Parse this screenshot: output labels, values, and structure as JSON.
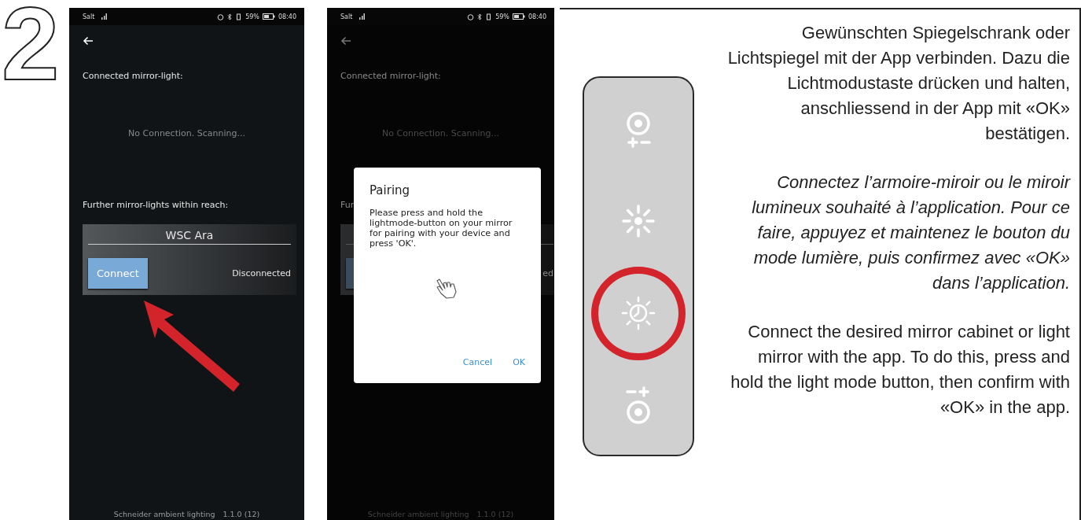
{
  "step_number": "2",
  "phones": [
    {
      "kind": "connect",
      "status_bar": {
        "carrier": "Salt",
        "battery": "59%",
        "time": "08:40"
      },
      "connected_label": "Connected mirror-light:",
      "scanning_text": "No Connection. Scanning...",
      "further_label": "Further mirror-lights within reach:",
      "device": {
        "name": "WSC Ara",
        "button": "Connect",
        "status": "Disconnected"
      },
      "footer": {
        "app_name": "Schneider ambient lighting",
        "version": "1.1.0 (12)"
      }
    },
    {
      "kind": "pairing",
      "status_bar": {
        "carrier": "Salt",
        "battery": "59%",
        "time": "08:40"
      },
      "connected_label": "Connected mirror-light:",
      "scanning_text": "No Connection. Scanning...",
      "further_label": "Fur",
      "device": {
        "status": "ed"
      },
      "footer": {
        "app_name": "Schneider ambient lighting",
        "version": "1.1.0 (12)"
      },
      "dialog": {
        "title": "Pairing",
        "message": "Please press and hold the lightmode-button on your mirror for pairing with your device and press 'OK'.",
        "buttons": [
          "Cancel",
          "OK"
        ]
      }
    }
  ],
  "mirror_control": {
    "buttons": [
      {
        "kind": "brightness-plus-minus",
        "circled": false
      },
      {
        "kind": "sun",
        "circled": false
      },
      {
        "kind": "timer-sun",
        "circled": true
      },
      {
        "kind": "minus-plus",
        "circled": false
      }
    ]
  },
  "instructions": [
    {
      "kind": "normal",
      "text": "Gewünschten Spiegelschrank oder Lichtspiegel mit der App verbinden. Dazu die Lichtmodustaste drücken und halten, anschliessend in der App mit «OK» bestätigen."
    },
    {
      "kind": "italic",
      "text": "Connectez l’armoire-miroir ou le miroir lumineux souhaité à l’application. Pour ce faire, appuyez et maintenez le bouton du mode lumière, puis confirmez avec «OK» dans l’application."
    },
    {
      "kind": "normal",
      "text": "Connect the desired mirror cabinet or light mirror with the app. To do this, press and hold the light mode button, then confirm with «OK» in the app."
    }
  ]
}
